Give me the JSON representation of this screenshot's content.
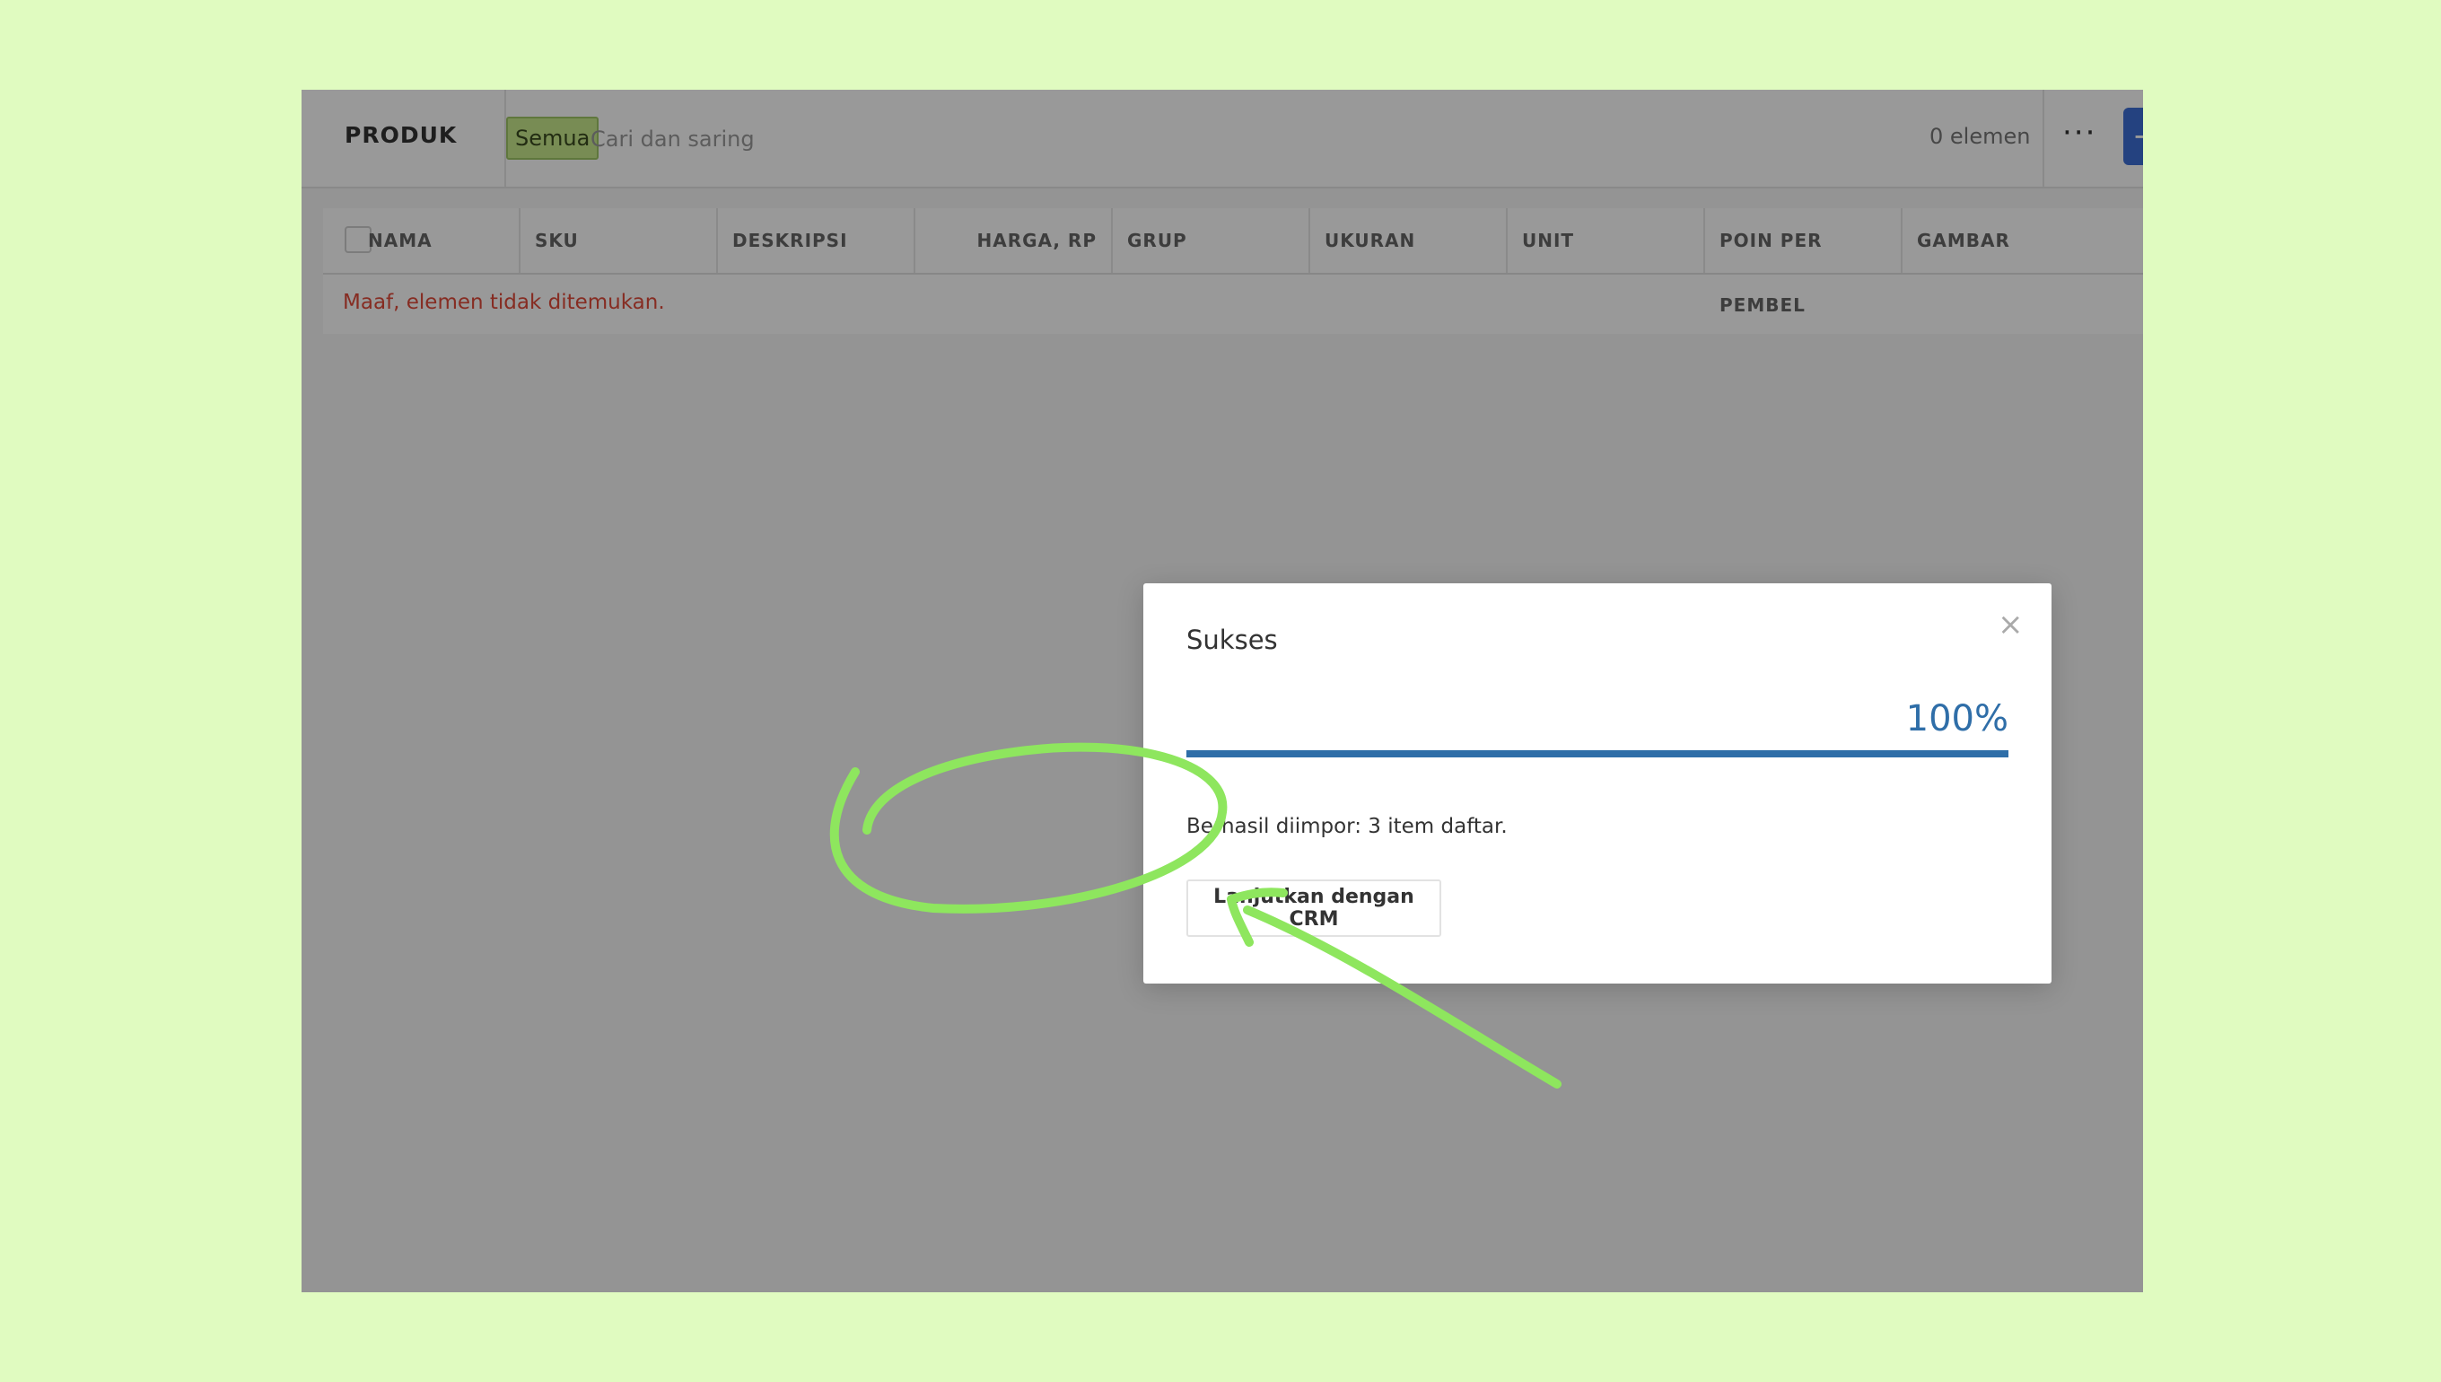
{
  "header": {
    "title": "PRODUK",
    "filter_chip": "Semua",
    "search_placeholder": "Cari dan saring",
    "count": "0 elemen",
    "more_glyph": "···",
    "add_glyph": "+"
  },
  "table": {
    "columns": [
      "NAMA",
      "SKU",
      "DESKRIPSI",
      "HARGA, RP",
      "GRUP",
      "UKURAN",
      "UNIT",
      "POIN PER PEMBEL",
      "GAMBAR"
    ],
    "empty_message": "Maaf, elemen tidak ditemukan."
  },
  "modal": {
    "title": "Sukses",
    "close_glyph": "×",
    "progress_value": 100,
    "progress_label": "100%",
    "message": "Berhasil diimpor: 3 item daftar.",
    "continue_label": "Lanjutkan dengan CRM"
  },
  "colors": {
    "page_background": "#e0fbc0",
    "annotation": "#8ee65e",
    "progress": "#2f6ea8",
    "add_button": "#3d6fd6",
    "error_text": "#e04a3a"
  },
  "icons": {
    "close": "close-icon",
    "more": "more-icon",
    "add": "add-icon"
  }
}
